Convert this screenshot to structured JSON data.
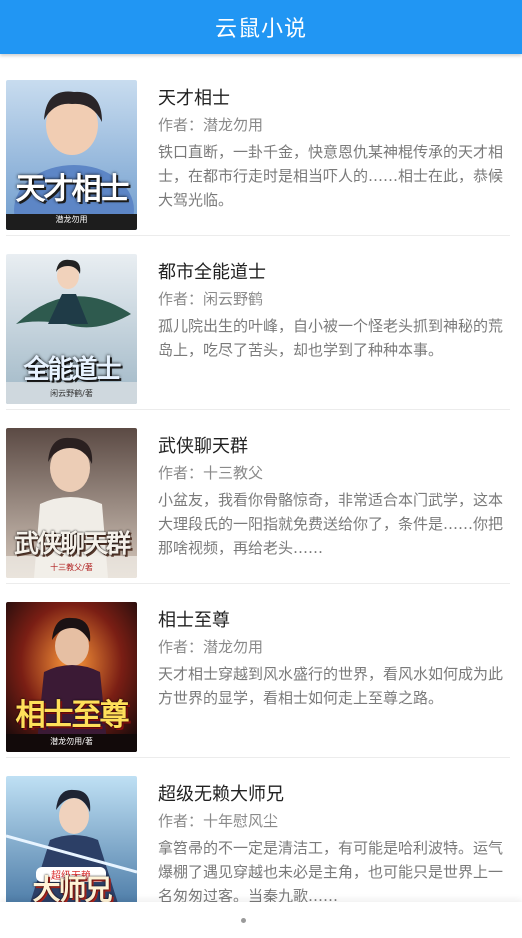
{
  "app": {
    "title": "云鼠小说"
  },
  "books": [
    {
      "title": "天才相士",
      "author": "作者：潜龙勿用",
      "description": "铁口直断，一卦千金，快意恩仇某神棍传承的天才相士，在都市行走时是相当吓人的……相士在此，恭候大驾光临。",
      "cover_title": "天才相士",
      "cover_author": "潜龙勿用"
    },
    {
      "title": "都市全能道士",
      "author": "作者：闲云野鹤",
      "description": "孤儿院出生的叶峰，自小被一个怪老头抓到神秘的荒岛上，吃尽了苦头，却也学到了种种本事。",
      "cover_title": "全能道士",
      "cover_author": "闲云野鹤/著"
    },
    {
      "title": "武侠聊天群",
      "author": "作者：十三教父",
      "description": "小盆友，我看你骨骼惊奇，非常适合本门武学，这本大理段氏的一阳指就免费送给你了，条件是……你把那啥视频，再给老头……",
      "cover_title": "武侠聊天群",
      "cover_author": "十三教父/著"
    },
    {
      "title": "相士至尊",
      "author": "作者：潜龙勿用",
      "description": "天才相士穿越到风水盛行的世界，看风水如何成为此方世界的显学，看相士如何走上至尊之路。",
      "cover_title": "相士至尊",
      "cover_author": "潜龙勿用/著"
    },
    {
      "title": "超级无赖大师兄",
      "author": "作者：十年慰风尘",
      "description": "拿笤帚的不一定是清洁工，有可能是哈利波特。运气爆棚了遇见穿越也未必是主角，也可能只是世界上一名匆匆过客。当秦九歌……",
      "cover_title": "大师兄",
      "cover_author": "超级无赖"
    }
  ],
  "colors": {
    "app_bar": "#2196f3",
    "title_text": "#222222",
    "meta_text": "#8a8a8a"
  }
}
